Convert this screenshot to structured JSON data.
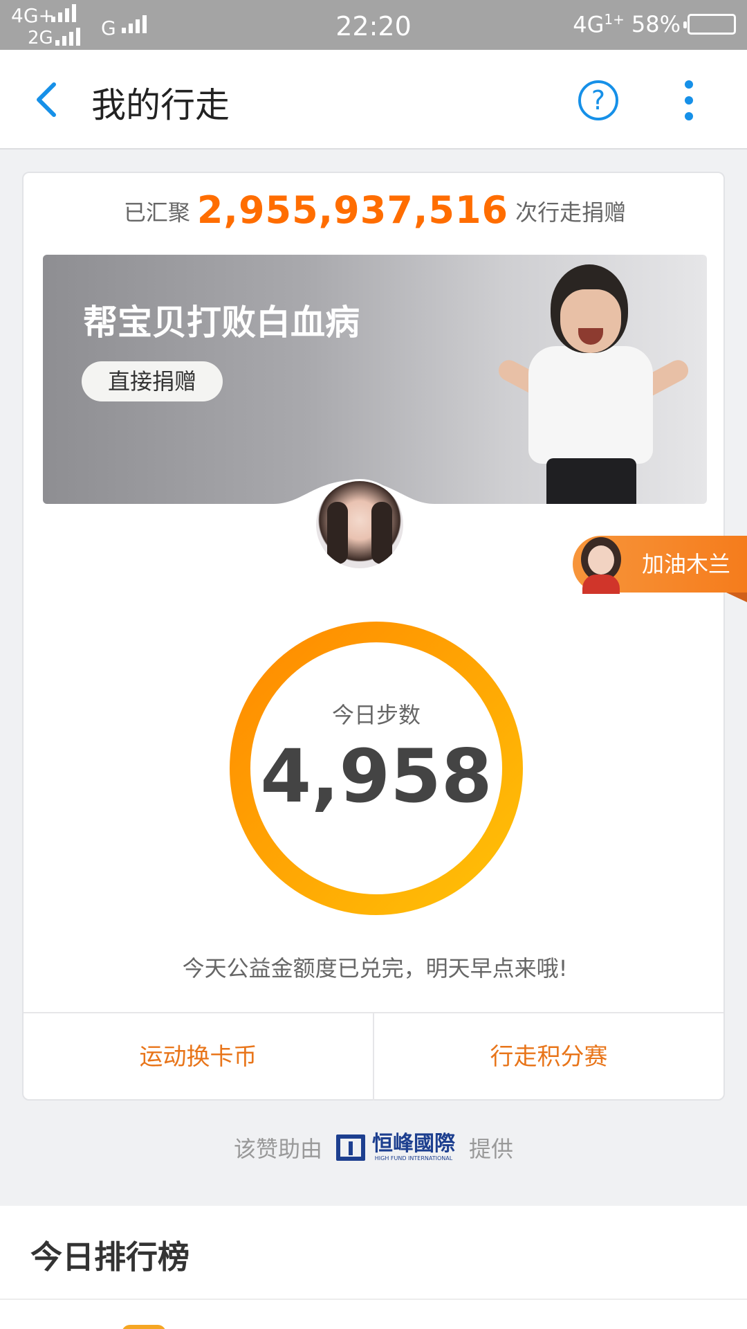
{
  "status_bar": {
    "network_1": "4G+",
    "network_2": "2G",
    "network_3": "G",
    "time": "22:20",
    "network_right": "4G",
    "network_right_sup": "1+",
    "battery": "58%"
  },
  "nav": {
    "title": "我的行走",
    "help_glyph": "?"
  },
  "summary": {
    "prefix": "已汇聚",
    "total": "2,955,937,516",
    "suffix": "次行走捐赠"
  },
  "banner": {
    "title": "帮宝贝打败白血病",
    "button": "直接捐赠"
  },
  "steps": {
    "label": "今日步数",
    "value": "4,958",
    "ring_colors": [
      "#ff8a00",
      "#ffc107"
    ]
  },
  "message": "今天公益金额度已兑完，明天早点来哦!",
  "actions": [
    {
      "label": "运动换卡币"
    },
    {
      "label": "行走积分赛"
    }
  ],
  "floating_tag": {
    "label": "加油木兰"
  },
  "sponsor": {
    "prefix": "该赞助由",
    "logo_cn": "恒峰國際",
    "logo_en": "HIGH FUND INTERNATIONAL",
    "suffix": "提供"
  },
  "ranking": {
    "title": "今日排行榜"
  },
  "colors": {
    "accent_blue": "#1690e8",
    "accent_orange": "#ff6d00",
    "action_orange": "#e8751a"
  }
}
